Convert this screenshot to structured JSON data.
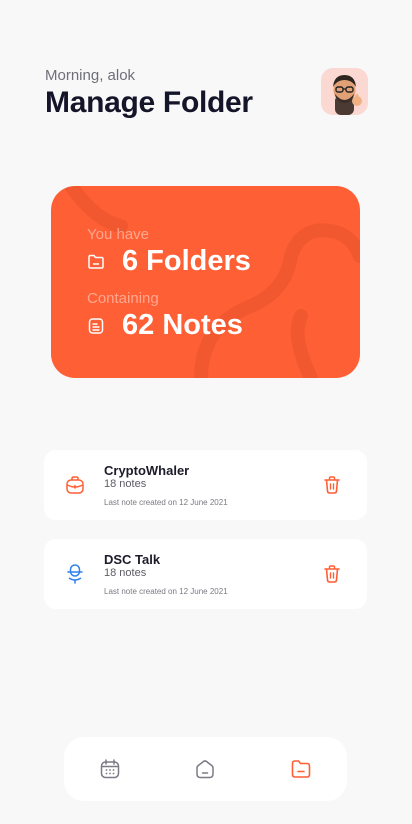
{
  "header": {
    "greeting": "Morning, alok",
    "title": "Manage Folder",
    "avatar_icon": "memoji-avatar"
  },
  "summary": {
    "folders_label": "You have",
    "folders_value": "6 Folders",
    "notes_label": "Containing",
    "notes_value": "62 Notes",
    "card_color": "#ff5f34"
  },
  "folders": [
    {
      "name": "CryptoWhaler",
      "count": "18 notes",
      "meta": "Last note created on 12 June 2021",
      "icon": "briefcase-icon",
      "icon_color": "#ff5f34"
    },
    {
      "name": "DSC Talk",
      "count": "18 notes",
      "meta": "Last note created on 12 June 2021",
      "icon": "microphone-icon",
      "icon_color": "#2f80ed"
    }
  ],
  "bottom_nav": {
    "tabs": [
      "calendar-icon",
      "home-icon",
      "folder-icon"
    ],
    "active_tab": "folder-icon",
    "active_color": "#ff5f34"
  }
}
